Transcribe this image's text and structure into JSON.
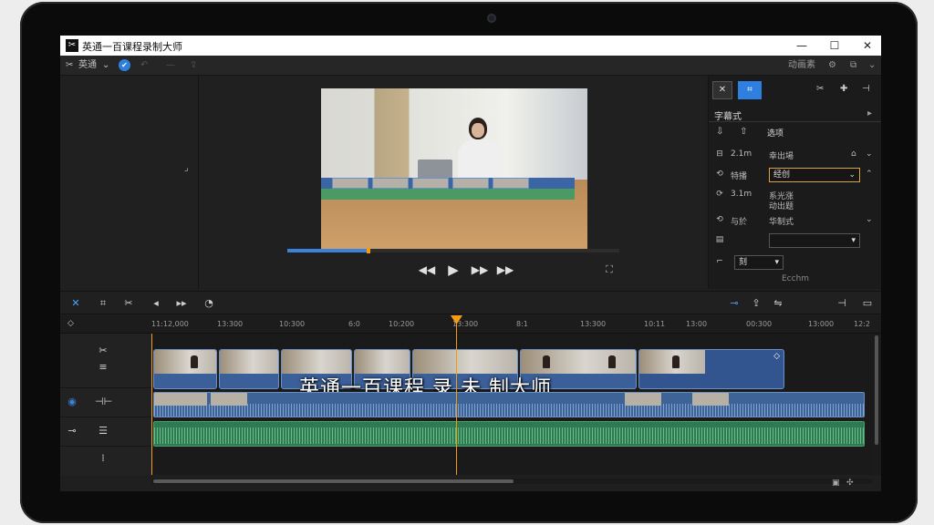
{
  "window": {
    "title": "英通一百课程录制大师",
    "logo": "✂"
  },
  "window_controls": {
    "minimize": "—",
    "maximize": "☐",
    "close": "✕"
  },
  "menu": {
    "app": "英通",
    "right_label": "动画素"
  },
  "preview": {
    "rewind": "◀◀",
    "play": "▶",
    "forward": "▶▶",
    "next": "▶▶",
    "fullscreen": "⛶",
    "progress": 0.245
  },
  "right_panel": {
    "section": "字幕式",
    "tab_label": "选项",
    "rows": [
      {
        "icon": "⊟",
        "key": "2.1m",
        "value": "幸出場"
      },
      {
        "icon": "⟲",
        "key": "特播",
        "value": "经创"
      },
      {
        "icon": "⟳",
        "key": "3.1m",
        "value": "系光涨"
      },
      {
        "icon": "⟲",
        "key": "与於",
        "value": "华制式"
      }
    ],
    "effects": "动出题",
    "mark_label": "刻",
    "footer": "Ecchm"
  },
  "timeline": {
    "ticks": [
      "11:12,000",
      "13:300",
      "10:300",
      "6:0",
      "10:200",
      "13:300",
      "8:1",
      "13:300",
      "10:11",
      "13:00",
      "00:300",
      "13:000",
      "12:2"
    ],
    "caption": "英通一百课程 录 未 制大师"
  }
}
